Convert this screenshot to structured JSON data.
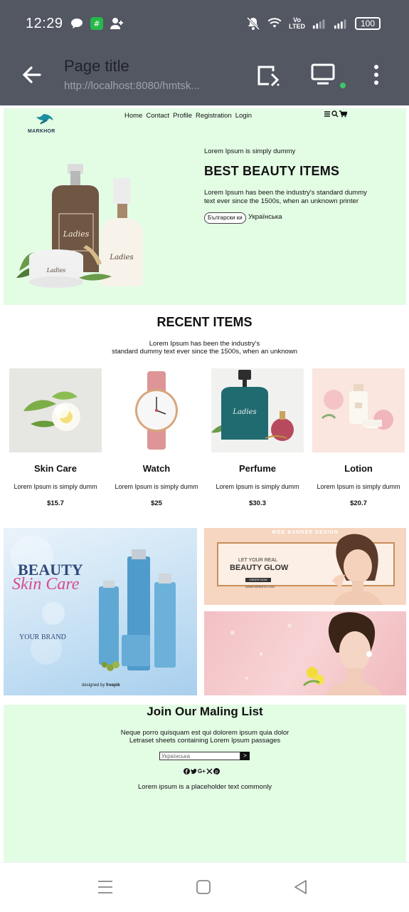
{
  "status_bar": {
    "time": "12:29",
    "volte_line1": "Vo",
    "volte_line2": "LTED",
    "battery": "100",
    "icons": [
      "chat-bubble-icon",
      "app-icon",
      "add-user-icon",
      "mute-bell-icon",
      "wifi-icon",
      "signal-icon",
      "signal-icon",
      "battery-icon"
    ]
  },
  "browser": {
    "title": "Page title",
    "url": "http://localhost:8080/hmtsk...",
    "icons": [
      "back-arrow-icon",
      "cast-icon",
      "screen-icon",
      "more-icon"
    ]
  },
  "site": {
    "logo_text": "MARKHOR",
    "nav": [
      "Home",
      "Contact",
      "Profile",
      "Registration",
      "Login"
    ],
    "nav_icons": [
      "menu-icon",
      "search-icon",
      "cart-icon"
    ],
    "hero": {
      "kicker": "Lorem Ipsum is simply dummy",
      "title": "BEST BEAUTY ITEMS",
      "description": "Lorem Ipsum has been the industry's standard dummy text ever since the 1500s, when an unknown printer",
      "language_button": "Български ки",
      "language_text": "Українська"
    },
    "recent": {
      "title": "RECENT ITEMS",
      "description_line1": "Lorem Ipsum has been the industry's",
      "description_line2": "standard dummy text ever since the 1500s, when an unknown",
      "products": [
        {
          "name": "Skin Care",
          "desc": "Lorem Ipsum is simply dumm",
          "price": "$15.7"
        },
        {
          "name": "Watch",
          "desc": "Lorem Ipsum is simply dumm",
          "price": "$25"
        },
        {
          "name": "Perfume",
          "desc": "Lorem Ipsum is simply dumm",
          "price": "$30.3"
        },
        {
          "name": "Lotion",
          "desc": "Lorem Ipsum is simply dumm",
          "price": "$20.7"
        }
      ]
    },
    "banners": {
      "left_title1": "BEAUTY",
      "left_title2": "Skin Care",
      "left_brand": "YOUR BRAND",
      "left_credit": "designed by ",
      "left_credit_brand": "freepik",
      "right_top_heading": "WEB BANNER DESIGN",
      "right_top_line1": "LET YOUR REAL",
      "right_top_line2": "BEAUTY GLOW",
      "right_top_cta": "ORDER NOW",
      "right_top_site": "WWW.WEBSITE.COM"
    },
    "newsletter": {
      "title": "Join Our Maling List",
      "desc_line1": "Neque porro quisquam est qui dolorem ipsum quia dolor",
      "desc_line2": "Letraset sheets containing Lorem Ipsum passages",
      "input_value": "Українська",
      "submit_label": ">",
      "social_icons": [
        "facebook-icon",
        "twitter-icon",
        "google-plus-icon",
        "x-icon",
        "pinterest-icon"
      ],
      "google_text": "G+",
      "footer": "Lorem ipsum is a placeholder text commonly"
    }
  },
  "colors": {
    "browser_bar": "#525762",
    "hero_bg": "#e3fde5",
    "online_dot": "#3fc66b"
  }
}
